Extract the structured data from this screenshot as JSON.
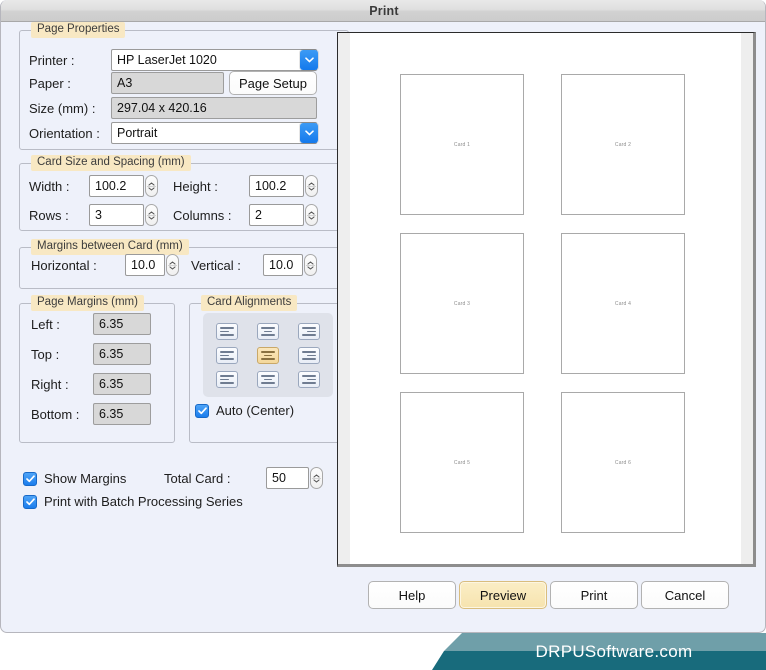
{
  "window": {
    "title": "Print"
  },
  "page_properties": {
    "legend": "Page Properties",
    "printer_label": "Printer :",
    "printer_value": "HP LaserJet 1020",
    "paper_label": "Paper :",
    "paper_value": "A3",
    "page_setup_button": "Page Setup",
    "size_label": "Size (mm) :",
    "size_value": "297.04 x 420.16",
    "orientation_label": "Orientation :",
    "orientation_value": "Portrait"
  },
  "card_size": {
    "legend": "Card Size and Spacing (mm)",
    "width_label": "Width :",
    "width_value": "100.2",
    "height_label": "Height :",
    "height_value": "100.2",
    "rows_label": "Rows :",
    "rows_value": "3",
    "columns_label": "Columns :",
    "columns_value": "2"
  },
  "margins_between": {
    "legend": "Margins between Card (mm)",
    "horizontal_label": "Horizontal :",
    "horizontal_value": "10.0",
    "vertical_label": "Vertical :",
    "vertical_value": "10.0"
  },
  "page_margins": {
    "legend": "Page Margins (mm)",
    "left_label": "Left :",
    "left_value": "6.35",
    "top_label": "Top :",
    "top_value": "6.35",
    "right_label": "Right :",
    "right_value": "6.35",
    "bottom_label": "Bottom :",
    "bottom_value": "6.35"
  },
  "card_alignments": {
    "legend": "Card Alignments",
    "auto_center_label": "Auto (Center)",
    "auto_center_checked": true,
    "selected_cell": 4,
    "cells": [
      "align-top-left",
      "align-top-center",
      "align-top-right",
      "align-middle-left",
      "align-middle-center",
      "align-middle-right",
      "align-bottom-left",
      "align-bottom-center",
      "align-bottom-right"
    ]
  },
  "options": {
    "show_margins_label": "Show Margins",
    "show_margins_checked": true,
    "batch_label": "Print with Batch Processing Series",
    "batch_checked": true,
    "total_card_label": "Total Card :",
    "total_card_value": "50"
  },
  "preview": {
    "cards": [
      "Card 1",
      "Card 2",
      "Card 3",
      "Card 4",
      "Card 5",
      "Card 6"
    ]
  },
  "buttons": {
    "help": "Help",
    "preview": "Preview",
    "print": "Print",
    "cancel": "Cancel"
  },
  "brand": {
    "text": "DRPUSoftware.com"
  },
  "colors": {
    "accent_blue": "#1b7ded",
    "legend_bg": "#f8e8c3",
    "accent_button": "#f6e3ae",
    "brand_light": "#6f9fa9",
    "brand_dark": "#186b7c",
    "window_bg": "#eef1fa"
  }
}
